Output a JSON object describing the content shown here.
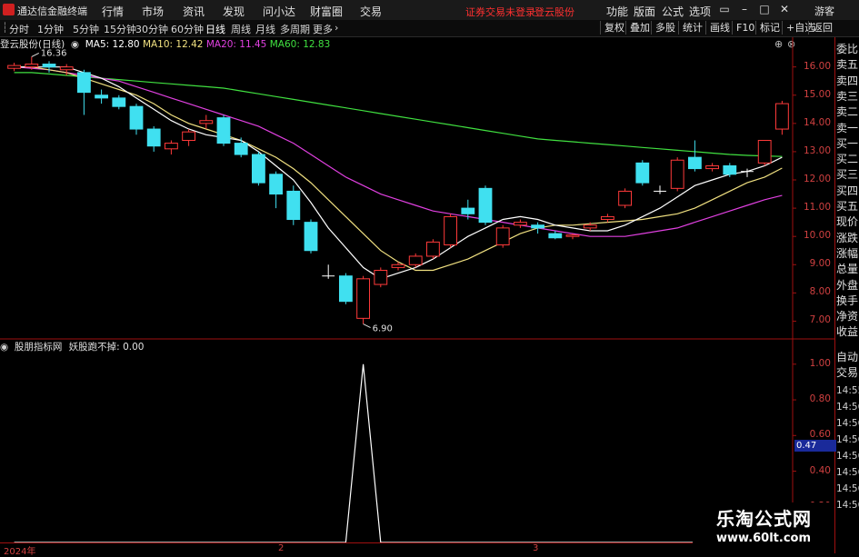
{
  "menubar": {
    "app_title": "通达信金融终端",
    "items": [
      "行情",
      "市场",
      "资讯",
      "发现",
      "问小达",
      "财富圈",
      "交易"
    ],
    "notice": "证券交易未登录",
    "stock_name": "登云股份",
    "right_items": [
      "功能",
      "版面",
      "公式",
      "选项"
    ],
    "guest": "游客"
  },
  "toolbar": {
    "periods": [
      "分时",
      "1分钟",
      "5分钟",
      "15分钟",
      "30分钟",
      "60分钟",
      "日线",
      "周线",
      "月线",
      "多周期",
      "更多"
    ],
    "active_period": "日线",
    "more_arrow": "›",
    "buttons": [
      "复权",
      "叠加",
      "多股",
      "统计",
      "画线",
      "F10",
      "标记",
      "+自选",
      "返回"
    ]
  },
  "main_chart": {
    "title": "登云股份(日线)",
    "ma": [
      {
        "label": "MA5: 12.80",
        "color": "#ffffff"
      },
      {
        "label": "MA10: 12.42",
        "color": "#f0e080"
      },
      {
        "label": "MA20: 11.45",
        "color": "#e040e0"
      },
      {
        "label": "MA60: 12.83",
        "color": "#40e040"
      }
    ],
    "y_ticks": [
      "16.00",
      "15.00",
      "14.00",
      "13.00",
      "12.00",
      "11.00",
      "10.00",
      "9.00",
      "8.00",
      "7.00"
    ],
    "high_label": "16.36",
    "low_label": "6.90"
  },
  "sub_chart": {
    "name": "股朋指标网",
    "indicator": "妖股跑不掉: 0.00",
    "y_ticks": [
      "1.00",
      "0.80",
      "0.60",
      "0.40",
      "0.20"
    ]
  },
  "date_axis": [
    "2024年",
    "2",
    "3"
  ],
  "right_panel": {
    "labels": [
      "委比",
      "卖五",
      "卖四",
      "卖三",
      "卖二",
      "卖一",
      "买一",
      "买二",
      "买三",
      "买四",
      "买五",
      "现价",
      "涨跌",
      "涨幅",
      "总量",
      "外盘",
      "换手",
      "净资",
      "收益"
    ],
    "auto_trade": [
      "自动",
      "交易"
    ],
    "times": [
      "14:55",
      "14:56",
      "14:56",
      "14:56",
      "14:56",
      "14:56",
      "14:56",
      "14:56"
    ],
    "value_box": "0.47"
  },
  "watermark": {
    "title": "乐淘公式网",
    "url": "www.60lt.com"
  },
  "chart_data": {
    "type": "candlestick",
    "title": "登云股份(日线)",
    "candles": [
      {
        "o": 15.95,
        "c": 16.05,
        "h": 16.15,
        "l": 15.85
      },
      {
        "o": 16.0,
        "c": 16.1,
        "h": 16.36,
        "l": 15.9
      },
      {
        "o": 16.1,
        "c": 16.0,
        "h": 16.2,
        "l": 15.8
      },
      {
        "o": 15.9,
        "c": 16.0,
        "h": 16.1,
        "l": 15.7
      },
      {
        "o": 15.8,
        "c": 15.1,
        "h": 15.9,
        "l": 14.3
      },
      {
        "o": 15.0,
        "c": 14.9,
        "h": 15.2,
        "l": 14.7
      },
      {
        "o": 14.9,
        "c": 14.6,
        "h": 15.0,
        "l": 14.5
      },
      {
        "o": 14.6,
        "c": 13.8,
        "h": 14.7,
        "l": 13.6
      },
      {
        "o": 13.8,
        "c": 13.2,
        "h": 13.9,
        "l": 13.0
      },
      {
        "o": 13.1,
        "c": 13.3,
        "h": 13.4,
        "l": 12.9
      },
      {
        "o": 13.4,
        "c": 13.7,
        "h": 13.8,
        "l": 13.2
      },
      {
        "o": 14.0,
        "c": 14.1,
        "h": 14.3,
        "l": 13.8
      },
      {
        "o": 14.2,
        "c": 13.3,
        "h": 14.3,
        "l": 13.2
      },
      {
        "o": 13.3,
        "c": 12.9,
        "h": 13.5,
        "l": 12.8
      },
      {
        "o": 12.9,
        "c": 11.9,
        "h": 13.0,
        "l": 11.8
      },
      {
        "o": 12.2,
        "c": 11.5,
        "h": 12.3,
        "l": 11.0
      },
      {
        "o": 11.6,
        "c": 10.6,
        "h": 11.8,
        "l": 10.4
      },
      {
        "o": 10.5,
        "c": 9.5,
        "h": 10.6,
        "l": 9.4
      },
      {
        "o": 8.6,
        "c": 8.6,
        "h": 9.0,
        "l": 8.5
      },
      {
        "o": 8.6,
        "c": 7.7,
        "h": 8.7,
        "l": 7.6
      },
      {
        "o": 7.1,
        "c": 8.5,
        "h": 8.6,
        "l": 6.9
      },
      {
        "o": 8.3,
        "c": 8.8,
        "h": 8.9,
        "l": 8.2
      },
      {
        "o": 8.9,
        "c": 9.0,
        "h": 9.1,
        "l": 8.8
      },
      {
        "o": 9.0,
        "c": 9.3,
        "h": 9.4,
        "l": 8.9
      },
      {
        "o": 9.3,
        "c": 9.8,
        "h": 9.9,
        "l": 9.2
      },
      {
        "o": 9.7,
        "c": 10.7,
        "h": 10.8,
        "l": 9.6
      },
      {
        "o": 11.0,
        "c": 10.8,
        "h": 11.3,
        "l": 10.6
      },
      {
        "o": 11.7,
        "c": 10.5,
        "h": 11.8,
        "l": 10.4
      },
      {
        "o": 9.7,
        "c": 10.3,
        "h": 10.4,
        "l": 9.6
      },
      {
        "o": 10.4,
        "c": 10.5,
        "h": 10.6,
        "l": 10.3
      },
      {
        "o": 10.4,
        "c": 10.3,
        "h": 10.5,
        "l": 10.1
      },
      {
        "o": 10.1,
        "c": 9.95,
        "h": 10.2,
        "l": 9.9
      },
      {
        "o": 10.0,
        "c": 10.05,
        "h": 10.1,
        "l": 9.9
      },
      {
        "o": 10.3,
        "c": 10.4,
        "h": 10.5,
        "l": 10.2
      },
      {
        "o": 10.6,
        "c": 10.7,
        "h": 10.8,
        "l": 10.5
      },
      {
        "o": 11.1,
        "c": 11.6,
        "h": 11.7,
        "l": 11.0
      },
      {
        "o": 12.6,
        "c": 11.9,
        "h": 12.7,
        "l": 11.8
      },
      {
        "o": 11.6,
        "c": 11.6,
        "h": 11.8,
        "l": 11.5
      },
      {
        "o": 11.7,
        "c": 12.7,
        "h": 12.8,
        "l": 11.6
      },
      {
        "o": 12.8,
        "c": 12.4,
        "h": 13.4,
        "l": 12.3
      },
      {
        "o": 12.4,
        "c": 12.5,
        "h": 12.6,
        "l": 12.3
      },
      {
        "o": 12.5,
        "c": 12.2,
        "h": 12.6,
        "l": 12.1
      },
      {
        "o": 12.3,
        "c": 12.3,
        "h": 12.4,
        "l": 12.1
      },
      {
        "o": 12.6,
        "c": 13.4,
        "h": 13.4,
        "l": 12.5
      },
      {
        "o": 13.8,
        "c": 14.7,
        "h": 14.8,
        "l": 13.6
      }
    ],
    "ma5": [
      16.0,
      16.0,
      16.0,
      16.0,
      15.8,
      15.6,
      15.3,
      14.9,
      14.5,
      14.1,
      13.8,
      13.6,
      13.5,
      13.4,
      13.0,
      12.5,
      12.0,
      11.2,
      10.3,
      9.6,
      8.9,
      8.5,
      8.7,
      8.9,
      9.2,
      9.6,
      10.0,
      10.3,
      10.6,
      10.7,
      10.6,
      10.4,
      10.3,
      10.2,
      10.2,
      10.4,
      10.7,
      11.0,
      11.4,
      11.8,
      12.0,
      12.2,
      12.3,
      12.5,
      12.8
    ],
    "ma10": [
      16.0,
      16.0,
      15.9,
      15.8,
      15.6,
      15.4,
      15.2,
      15.0,
      14.7,
      14.3,
      14.0,
      13.8,
      13.6,
      13.4,
      13.1,
      12.8,
      12.4,
      11.9,
      11.3,
      10.7,
      10.1,
      9.5,
      9.1,
      8.8,
      8.8,
      9.0,
      9.2,
      9.5,
      9.8,
      10.1,
      10.3,
      10.4,
      10.4,
      10.45,
      10.5,
      10.55,
      10.6,
      10.7,
      10.8,
      11.0,
      11.3,
      11.6,
      11.9,
      12.1,
      12.42
    ],
    "ma20": [
      16.0,
      15.95,
      15.9,
      15.8,
      15.7,
      15.6,
      15.5,
      15.3,
      15.1,
      14.9,
      14.7,
      14.5,
      14.3,
      14.1,
      13.9,
      13.6,
      13.3,
      12.9,
      12.5,
      12.1,
      11.8,
      11.5,
      11.3,
      11.1,
      10.9,
      10.8,
      10.7,
      10.6,
      10.5,
      10.4,
      10.3,
      10.2,
      10.1,
      10.0,
      10.0,
      10.0,
      10.1,
      10.2,
      10.3,
      10.5,
      10.7,
      10.9,
      11.1,
      11.3,
      11.45
    ],
    "ma60": [
      15.8,
      15.8,
      15.75,
      15.7,
      15.65,
      15.6,
      15.55,
      15.5,
      15.45,
      15.4,
      15.35,
      15.3,
      15.25,
      15.15,
      15.05,
      14.95,
      14.85,
      14.75,
      14.65,
      14.55,
      14.45,
      14.35,
      14.25,
      14.15,
      14.05,
      13.95,
      13.85,
      13.75,
      13.65,
      13.55,
      13.45,
      13.4,
      13.35,
      13.3,
      13.25,
      13.2,
      13.15,
      13.1,
      13.05,
      13.0,
      12.95,
      12.9,
      12.87,
      12.85,
      12.83
    ],
    "indicator_series": {
      "name": "妖股跑不掉",
      "values": [
        0,
        0,
        0,
        0,
        0,
        0,
        0,
        0,
        0,
        0,
        0,
        0,
        0,
        0,
        0,
        0,
        0,
        0,
        0,
        0,
        1,
        0,
        0,
        0,
        0,
        0,
        0,
        0,
        0,
        0,
        0,
        0,
        0,
        0,
        0,
        0,
        0,
        0,
        0,
        0,
        0,
        0,
        0,
        0,
        0
      ]
    },
    "y_range": [
      6.5,
      16.6
    ],
    "sub_y_range": [
      0,
      1.05
    ],
    "colors": {
      "up": "#ff3a3a",
      "down": "#40e0f0",
      "flat": "#ffffff",
      "ma5": "#ffffff",
      "ma10": "#f0e080",
      "ma20": "#e040e0",
      "ma60": "#40e040",
      "indicator": "#ffffff",
      "axis": "#a01010"
    }
  }
}
